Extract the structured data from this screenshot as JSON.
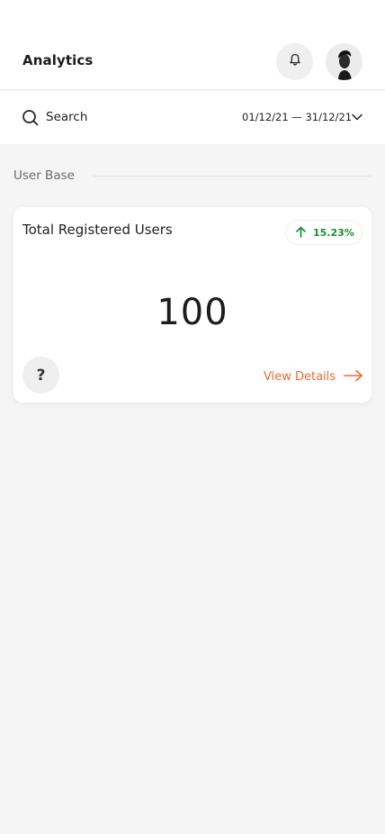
{
  "header": {
    "title": "Analytics",
    "notification_icon": "bell-icon",
    "avatar_icon": "user-avatar"
  },
  "search": {
    "label": "Search",
    "icon": "search-icon",
    "date_range": "01/12/21 — 31/12/21",
    "date_icon": "chevron-down-icon"
  },
  "section": {
    "label": "User Base"
  },
  "card": {
    "title": "Total Registered Users",
    "trend": "15.23%",
    "trend_icon": "arrow-up-icon",
    "value": "100",
    "help_label": "?",
    "link_label": "View Details",
    "link_icon": "arrow-right-icon"
  },
  "colors": {
    "accent": "#f26a2e",
    "positive": "#1e8c3a",
    "background": "#f5f5f5"
  }
}
